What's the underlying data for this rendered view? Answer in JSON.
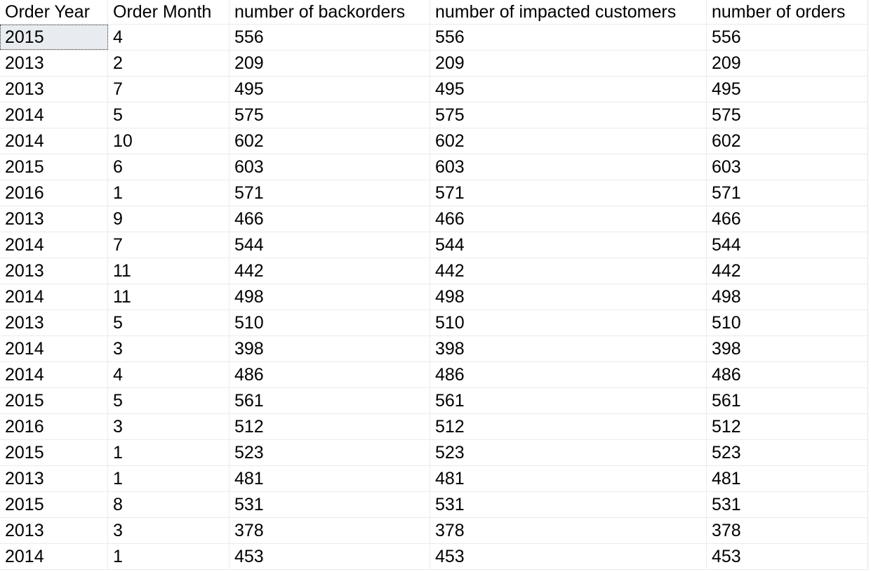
{
  "grid": {
    "columns": [
      "Order Year",
      "Order Month",
      "number of backorders",
      "number of impacted customers",
      "number of orders"
    ],
    "selected_cell": {
      "row": 0,
      "col": 0
    },
    "rows": [
      [
        "2015",
        "4",
        "556",
        "556",
        "556"
      ],
      [
        "2013",
        "2",
        "209",
        "209",
        "209"
      ],
      [
        "2013",
        "7",
        "495",
        "495",
        "495"
      ],
      [
        "2014",
        "5",
        "575",
        "575",
        "575"
      ],
      [
        "2014",
        "10",
        "602",
        "602",
        "602"
      ],
      [
        "2015",
        "6",
        "603",
        "603",
        "603"
      ],
      [
        "2016",
        "1",
        "571",
        "571",
        "571"
      ],
      [
        "2013",
        "9",
        "466",
        "466",
        "466"
      ],
      [
        "2014",
        "7",
        "544",
        "544",
        "544"
      ],
      [
        "2013",
        "11",
        "442",
        "442",
        "442"
      ],
      [
        "2014",
        "11",
        "498",
        "498",
        "498"
      ],
      [
        "2013",
        "5",
        "510",
        "510",
        "510"
      ],
      [
        "2014",
        "3",
        "398",
        "398",
        "398"
      ],
      [
        "2014",
        "4",
        "486",
        "486",
        "486"
      ],
      [
        "2015",
        "5",
        "561",
        "561",
        "561"
      ],
      [
        "2016",
        "3",
        "512",
        "512",
        "512"
      ],
      [
        "2015",
        "1",
        "523",
        "523",
        "523"
      ],
      [
        "2013",
        "1",
        "481",
        "481",
        "481"
      ],
      [
        "2015",
        "8",
        "531",
        "531",
        "531"
      ],
      [
        "2013",
        "3",
        "378",
        "378",
        "378"
      ],
      [
        "2014",
        "1",
        "453",
        "453",
        "453"
      ]
    ]
  }
}
